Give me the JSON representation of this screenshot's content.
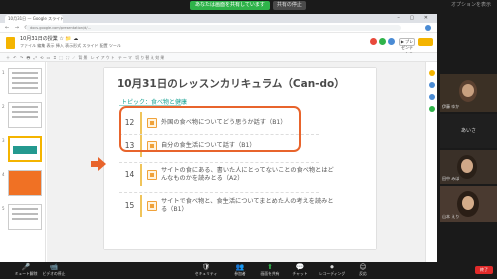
{
  "share_banner": {
    "sharing_label": "あなたは画面を共有しています",
    "stop_label": "共有の停止",
    "view_options": "オプションを表示"
  },
  "browser": {
    "tab_title": "10月31日 — Google スライド",
    "url": "docs.google.com/presentation/d/...",
    "doc_title": "10月31日の授業 ☆ 📁 ☁",
    "doc_menu": "ファイル 編集 表示 挿入 表示形式 スライド 配置 ツール",
    "present_label": "▶ プレゼンテーション",
    "toolbar_text": "＋ ↶ ↷ 🖶 ⤢ ⟲ ▭ ⌗ ⬚ ⛶ ⟋ 背景 レイアウト テーマ 切り替え効果",
    "nav_arrows": "← → ⟳",
    "window_buttons": "– ▢ ✕",
    "accent_color": "#f4b400"
  },
  "slides_panel": {
    "thumbnails": [
      {
        "num": "1",
        "style": "text"
      },
      {
        "num": "2",
        "style": "text"
      },
      {
        "num": "3",
        "style": "teal"
      },
      {
        "num": "4",
        "style": "orange"
      },
      {
        "num": "5",
        "style": "text"
      }
    ]
  },
  "slide": {
    "title": "10月31日のレッスンカリキュラム（Can-do）",
    "subtitle": "トピック：食べ物と健康",
    "lessons": [
      {
        "num": "12",
        "text": "外国の食べ物についてどう思うか話す（B1）"
      },
      {
        "num": "13",
        "text": "自分の食生活について話す（B1）"
      },
      {
        "num": "14",
        "text": "サイトの食にある、書いた人にとってないことの食べ物とはどんなものかを読みとる（A2）"
      },
      {
        "num": "15",
        "text": "サイトで食べ物と、食生活についてまとめた人の考えを読みとる（B1）"
      }
    ],
    "highlight_color": "#e8642c",
    "teal_color": "#1aa394"
  },
  "participants": [
    {
      "name": "伊藤 ゆか"
    },
    {
      "name": "あいさ"
    },
    {
      "name": "田中 みほ"
    },
    {
      "name": "山本 えり"
    }
  ],
  "zoom_toolbar": {
    "items": [
      {
        "icon": "🎤",
        "label": "ミュート解除",
        "kind": "mute"
      },
      {
        "icon": "📹",
        "label": "ビデオの停止",
        "kind": "normal"
      },
      {
        "icon": "🛡",
        "label": "セキュリティ",
        "kind": "normal"
      },
      {
        "icon": "👥",
        "label": "参加者",
        "kind": "normal"
      },
      {
        "icon": "⬆",
        "label": "画面を共有",
        "kind": "share"
      },
      {
        "icon": "💬",
        "label": "チャット",
        "kind": "normal"
      },
      {
        "icon": "⏺",
        "label": "レコーディング",
        "kind": "normal"
      },
      {
        "icon": "☺",
        "label": "反応",
        "kind": "normal"
      }
    ],
    "end_label": "終了"
  }
}
